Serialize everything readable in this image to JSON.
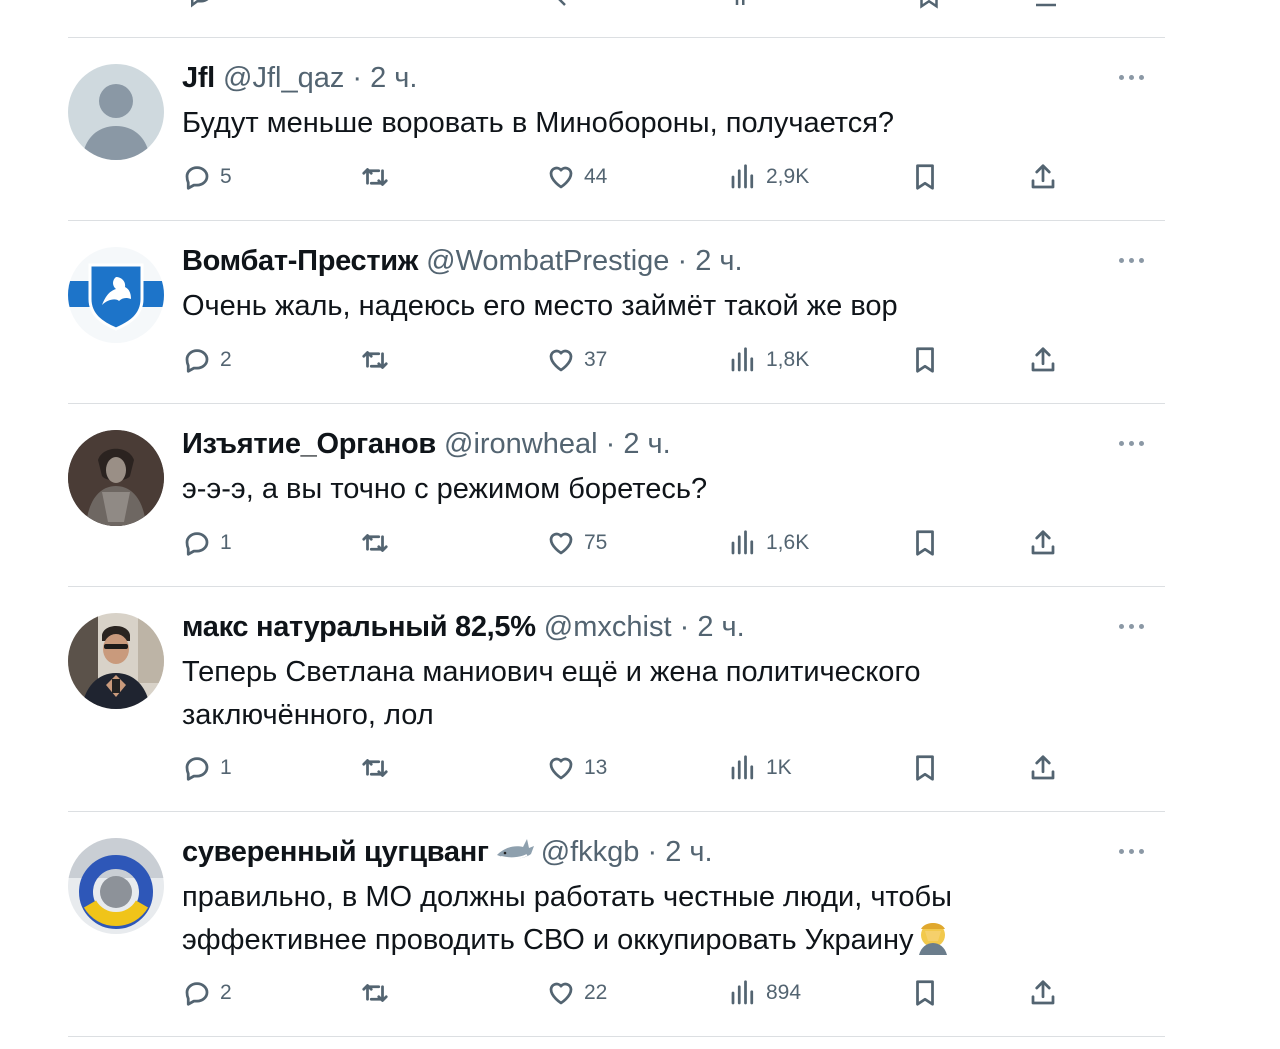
{
  "tweets": [
    {
      "name": "Jfl",
      "handle": "@Jfl_qaz",
      "time": "2 ч.",
      "text_lines": [
        "Будут меньше воровать в Минобороны, получается?"
      ],
      "replies": "5",
      "likes": "44",
      "views": "2,9K",
      "avatar": "default-avatar"
    },
    {
      "name": "Вомбат-Престиж",
      "handle": "@WombatPrestige",
      "time": "2 ч.",
      "text_lines": [
        "Очень жаль, надеюсь его место займёт такой же вор"
      ],
      "replies": "2",
      "likes": "37",
      "views": "1,8K",
      "avatar": "coat-of-arms-avatar"
    },
    {
      "name": "Изъятие_Органов",
      "handle": "@ironwheal",
      "time": "2 ч.",
      "text_lines": [
        "э-э-э, а вы точно с режимом боретесь?"
      ],
      "replies": "1",
      "likes": "75",
      "views": "1,6K",
      "avatar": "dark-figure-avatar"
    },
    {
      "name": "макс натуральный 82,5%",
      "handle": "@mxchist",
      "time": "2 ч.",
      "text_lines": [
        "Теперь Светлана маниович ещё и жена политического",
        "заключённого,  лол"
      ],
      "replies": "1",
      "likes": "13",
      "views": "1K",
      "avatar": "man-photo-avatar"
    },
    {
      "name": "суверенный цугцванг",
      "handle": "@fkkgb",
      "time": "2 ч.",
      "text_lines": [
        "правильно, в МО должны работать честные люди, чтобы",
        "эффективнее проводить СВО и оккупировать Украину"
      ],
      "replies": "2",
      "likes": "22",
      "views": "894",
      "avatar": "wreath-avatar",
      "name_emoji": "shark-emoji",
      "text_emoji": "facepalm-emoji"
    }
  ],
  "colors": {
    "text": "#0f1419",
    "secondary": "#536471",
    "divider": "#dcdfe2"
  }
}
